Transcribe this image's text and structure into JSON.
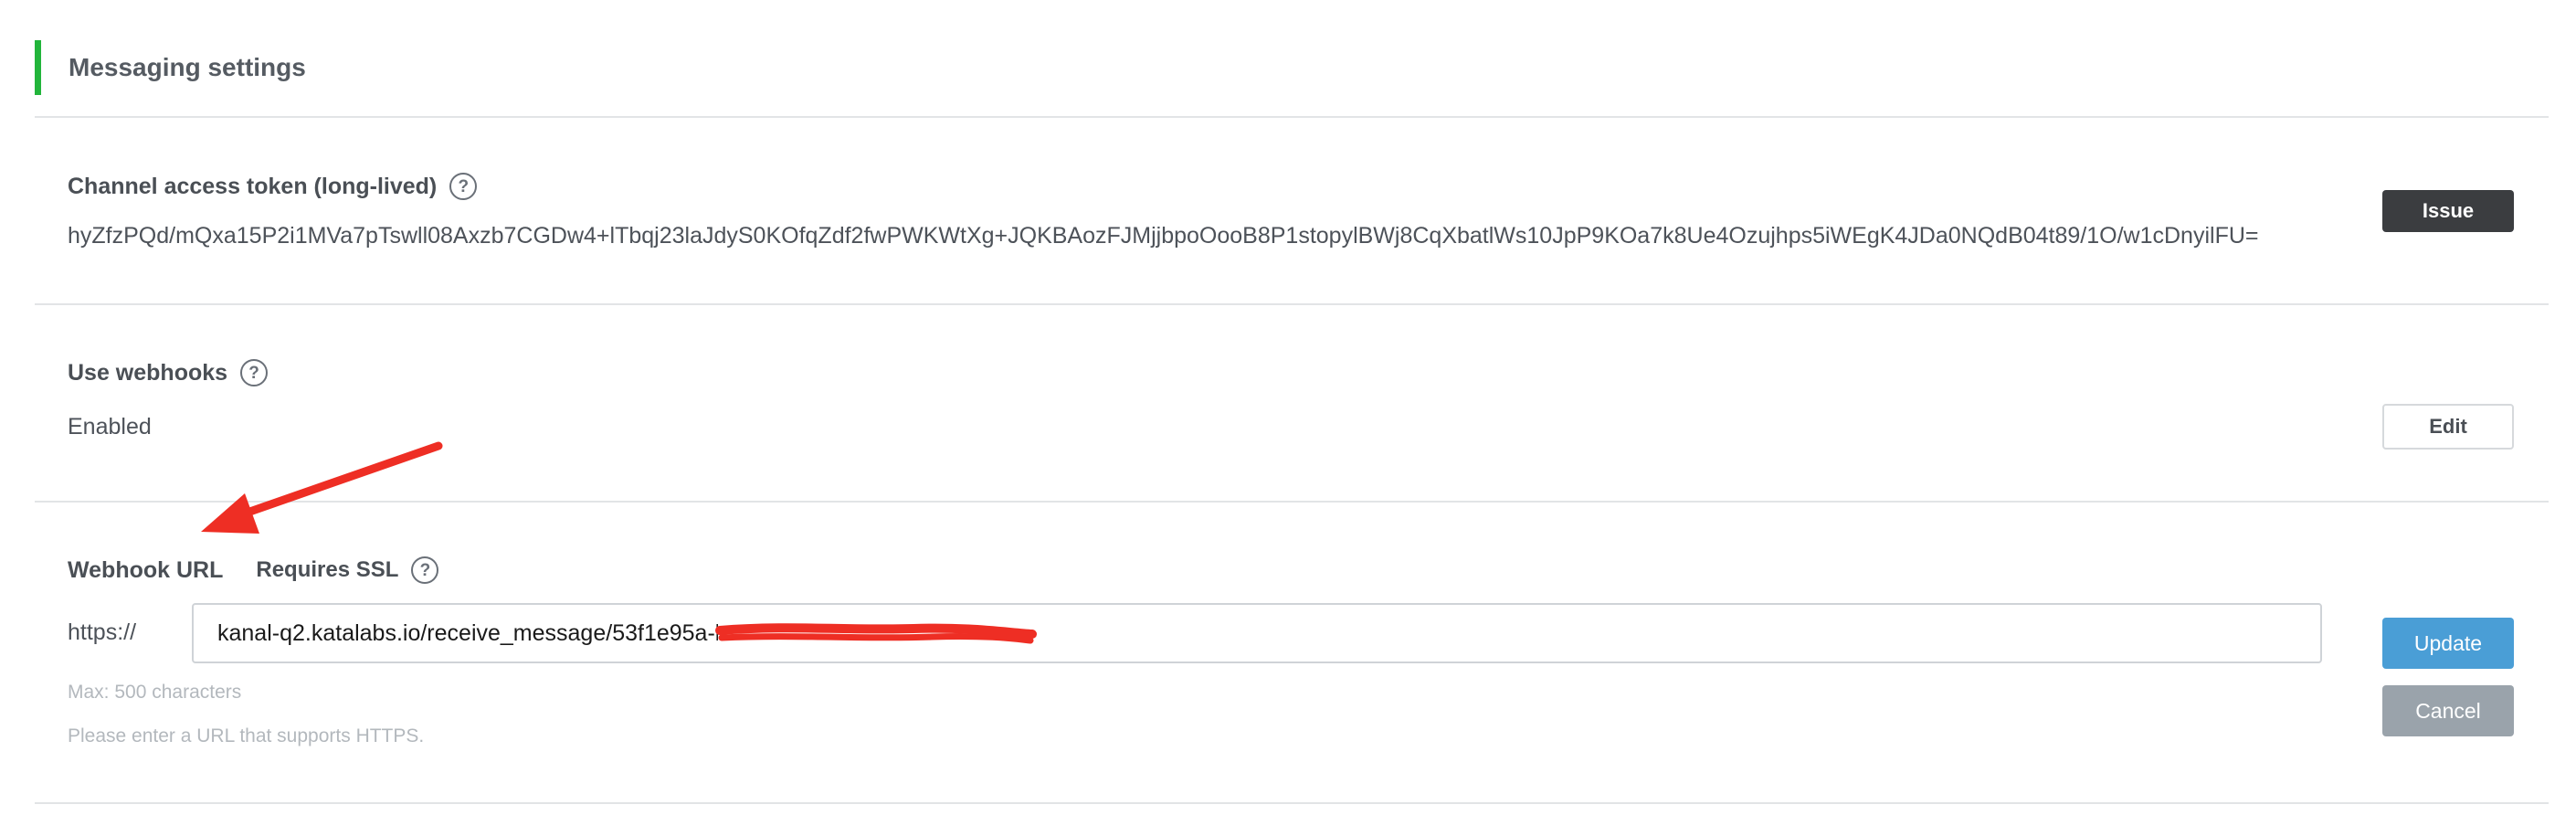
{
  "section": {
    "title": "Messaging settings",
    "accent_color": "#22b53b"
  },
  "channel_token": {
    "label": "Channel access token (long-lived)",
    "help_icon": "question-circle-icon",
    "value": "hyZfzPQd/mQxa15P2i1MVa7pTswll08Axzb7CGDw4+lTbqj23laJdyS0KOfqZdf2fwPWKWtXg+JQKBAozFJMjjbpoOooB8P1stopylBWj8CqXbatlWs10JpP9KOa7k8Ue4Ozujhps5iWEgK4JDa0NQdB04t89/1O/w1cDnyilFU=",
    "issue_button": "Issue"
  },
  "webhooks": {
    "label": "Use webhooks",
    "help_icon": "question-circle-icon",
    "status": "Enabled",
    "edit_button": "Edit"
  },
  "webhook_url": {
    "label": "Webhook URL",
    "ssl_label": "Requires SSL",
    "help_icon": "question-circle-icon",
    "prefix": "https://",
    "value": "kanal-q2.katalabs.io/receive_message/53f1e95a-b8c0-40fc-8a33-0cccc07f8891c",
    "max_hint": "Max: 500 characters",
    "https_hint": "Please enter a URL that supports HTTPS.",
    "update_button": "Update",
    "cancel_button": "Cancel"
  },
  "colors": {
    "issue_button_bg": "#3b3d40",
    "update_button_bg": "#4a9ed6",
    "cancel_button_bg": "#9aa3ab",
    "annotation_red": "#ee2e24"
  }
}
